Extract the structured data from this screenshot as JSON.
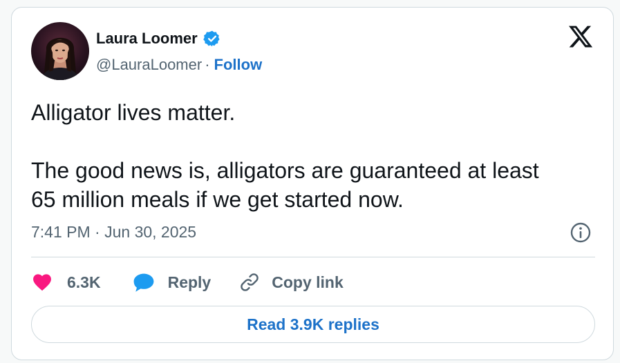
{
  "author": {
    "name": "Laura Loomer",
    "handle": "@LauraLoomer",
    "separator": "·",
    "follow_label": "Follow",
    "verified": true,
    "avatar_icon": "profile-photo"
  },
  "tweet": {
    "lines": [
      "Alligator lives matter.",
      "The good news is, alligators are guaranteed at least",
      "65 million meals if we get started now."
    ],
    "timestamp": "7:41 PM · Jun 30, 2025"
  },
  "actions": {
    "like_count": "6.3K",
    "reply_label": "Reply",
    "copy_link_label": "Copy link"
  },
  "read_replies_label": "Read 3.9K replies",
  "icons": {
    "brand": "x-logo-icon",
    "verified": "verified-badge-icon",
    "info": "info-icon",
    "like": "heart-icon",
    "reply": "speech-bubble-icon",
    "copy": "link-icon"
  },
  "colors": {
    "text": "#0f1419",
    "muted": "#536471",
    "link": "#1d72c9",
    "like": "#f91880",
    "reply": "#1d9bf0",
    "verified": "#1d9bf0",
    "border": "#cfd9de"
  }
}
